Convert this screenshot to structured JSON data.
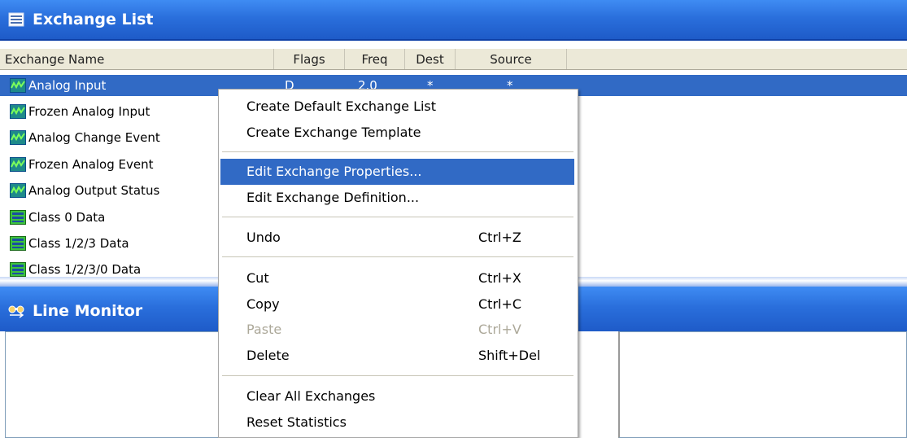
{
  "exchange_list": {
    "title": "Exchange List",
    "columns": [
      "Exchange Name",
      "Flags",
      "Freq",
      "Dest",
      "Source"
    ],
    "rows": [
      {
        "name": "Analog Input",
        "flags": "D",
        "freq": "2.0",
        "dest": "*",
        "source": "*",
        "icon": "analog-wave-icon",
        "selected": true
      },
      {
        "name": "Frozen Analog Input",
        "icon": "analog-wave-icon"
      },
      {
        "name": "Analog Change Event",
        "icon": "analog-wave-icon"
      },
      {
        "name": "Frozen Analog Event",
        "icon": "analog-wave-icon"
      },
      {
        "name": "Analog Output Status",
        "icon": "analog-wave-icon"
      },
      {
        "name": "Class 0 Data",
        "icon": "class-data-icon"
      },
      {
        "name": "Class 1/2/3 Data",
        "icon": "class-data-icon"
      },
      {
        "name": "Class 1/2/3/0 Data",
        "icon": "class-data-icon"
      }
    ]
  },
  "line_monitor": {
    "title": "Line Monitor"
  },
  "context_menu": {
    "groups": [
      [
        {
          "label": "Create Default Exchange List",
          "shortcut": ""
        },
        {
          "label": "Create Exchange Template",
          "shortcut": ""
        }
      ],
      [
        {
          "label": "Edit Exchange Properties...",
          "shortcut": "",
          "highlighted": true
        },
        {
          "label": "Edit Exchange Definition...",
          "shortcut": ""
        }
      ],
      [
        {
          "label": "Undo",
          "shortcut": "Ctrl+Z"
        }
      ],
      [
        {
          "label": "Cut",
          "shortcut": "Ctrl+X"
        },
        {
          "label": "Copy",
          "shortcut": "Ctrl+C"
        },
        {
          "label": "Paste",
          "shortcut": "Ctrl+V",
          "disabled": true
        },
        {
          "label": "Delete",
          "shortcut": "Shift+Del"
        }
      ],
      [
        {
          "label": "Clear All Exchanges",
          "shortcut": ""
        },
        {
          "label": "Reset Statistics",
          "shortcut": ""
        }
      ]
    ]
  },
  "colors": {
    "title_bar": "#2a6fdc",
    "selection": "#316ac5",
    "disabled_text": "#aca899"
  }
}
